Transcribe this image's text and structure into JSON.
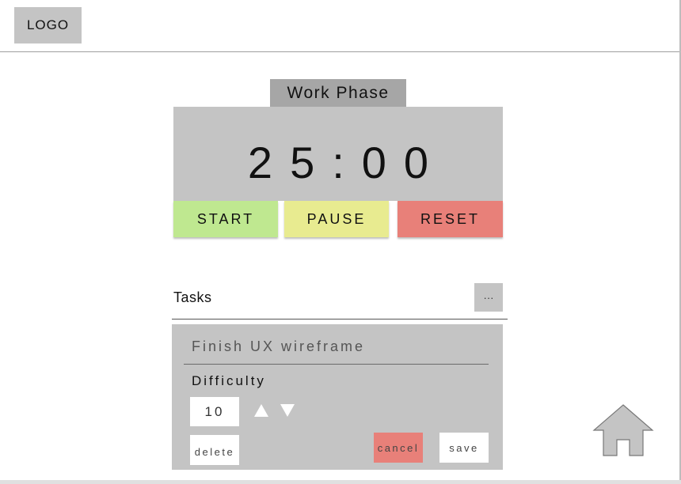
{
  "header": {
    "logo_label": "LOGO"
  },
  "timer": {
    "phase_label": "Work Phase",
    "display": "25:00",
    "buttons": {
      "start": "START",
      "pause": "PAUSE",
      "reset": "RESET"
    },
    "colors": {
      "start": "#bfe890",
      "pause": "#e8eb90",
      "reset": "#e88079"
    }
  },
  "tasks": {
    "label": "Tasks",
    "more_label": "···",
    "item": {
      "title": "Finish UX wireframe",
      "difficulty_label": "Difficulty",
      "difficulty_value": "10",
      "delete_label": "delete",
      "cancel_label": "cancel",
      "save_label": "save"
    }
  },
  "nav": {
    "home_icon": "home-icon"
  }
}
